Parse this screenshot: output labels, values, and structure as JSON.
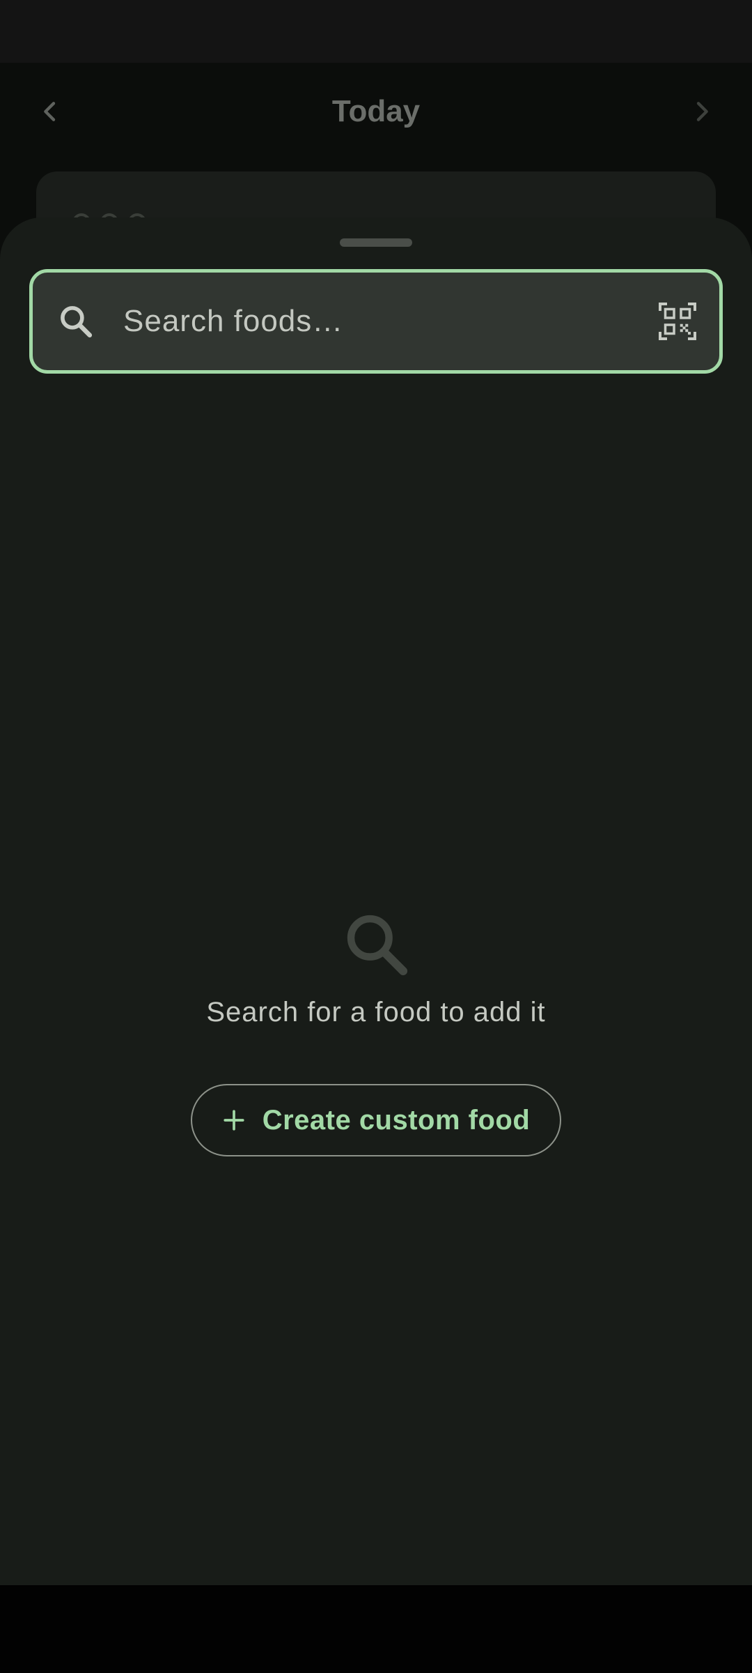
{
  "header": {
    "title": "Today",
    "prev_icon": "chevron-left-icon",
    "next_icon": "chevron-right-icon"
  },
  "sheet": {
    "search": {
      "placeholder": "Search foods…",
      "value": "",
      "leading_icon": "search-icon",
      "trailing_icon": "qr-code-scan-icon",
      "accent_color": "#a2d9a6"
    },
    "empty_state": {
      "icon": "search-icon",
      "message": "Search for a food to add it"
    },
    "create_button": {
      "icon": "plus-icon",
      "label": "Create custom food"
    }
  },
  "colors": {
    "accent": "#a2d9a6",
    "sheet_background": "#181c18",
    "app_background": "#0b0d0b"
  }
}
